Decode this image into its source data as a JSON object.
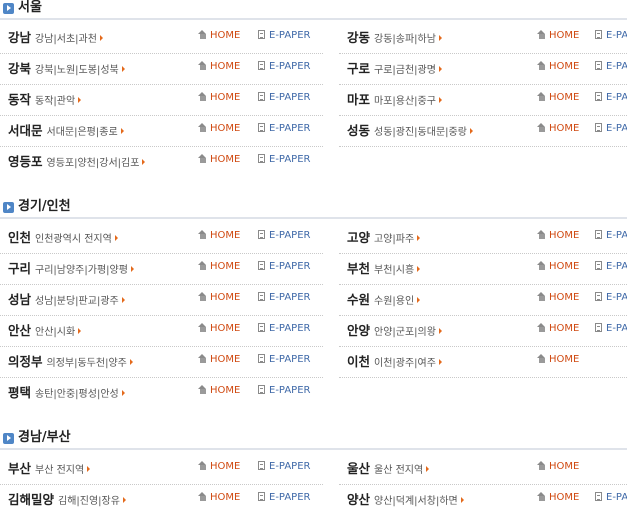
{
  "links": {
    "home": "HOME",
    "epaper": "E-PAPER"
  },
  "sections": [
    {
      "title": "서울",
      "left": [
        {
          "city": "강남",
          "sub": "강남|서초|과천"
        },
        {
          "city": "강북",
          "sub": "강북|노원|도봉|성북"
        },
        {
          "city": "동작",
          "sub": "동작|관악"
        },
        {
          "city": "서대문",
          "sub": "서대문|은평|종로"
        },
        {
          "city": "영등포",
          "sub": "영등포|양천|강서|김포"
        }
      ],
      "right": [
        {
          "city": "강동",
          "sub": "강동|송파|하남"
        },
        {
          "city": "구로",
          "sub": "구로|금천|광명"
        },
        {
          "city": "마포",
          "sub": "마포|용산|중구"
        },
        {
          "city": "성동",
          "sub": "성동|광진|동대문|중랑"
        }
      ]
    },
    {
      "title": "경기/인천",
      "left": [
        {
          "city": "인천",
          "sub": "인천광역시 전지역"
        },
        {
          "city": "구리",
          "sub": "구리|남양주|가평|양평"
        },
        {
          "city": "성남",
          "sub": "성남|분당|판교|광주"
        },
        {
          "city": "안산",
          "sub": "안산|시화"
        },
        {
          "city": "의정부",
          "sub": "의정부|동두천|양주"
        },
        {
          "city": "평택",
          "sub": "송탄|안중|평성|안성"
        }
      ],
      "right": [
        {
          "city": "고양",
          "sub": "고양|파주"
        },
        {
          "city": "부천",
          "sub": "부천|시흥"
        },
        {
          "city": "수원",
          "sub": "수원|용인"
        },
        {
          "city": "안양",
          "sub": "안양|군포|의왕"
        },
        {
          "city": "이천",
          "sub": "이천|광주|여주"
        }
      ]
    },
    {
      "title": "경남/부산",
      "left": [
        {
          "city": "부산",
          "sub": "부산 전지역"
        },
        {
          "city": "김해밀양",
          "sub": "김해|진영|장유"
        }
      ],
      "right": [
        {
          "city": "울산",
          "sub": "울산 전지역"
        },
        {
          "city": "양산",
          "sub": "양산|덕계|서창|하면"
        }
      ]
    }
  ]
}
